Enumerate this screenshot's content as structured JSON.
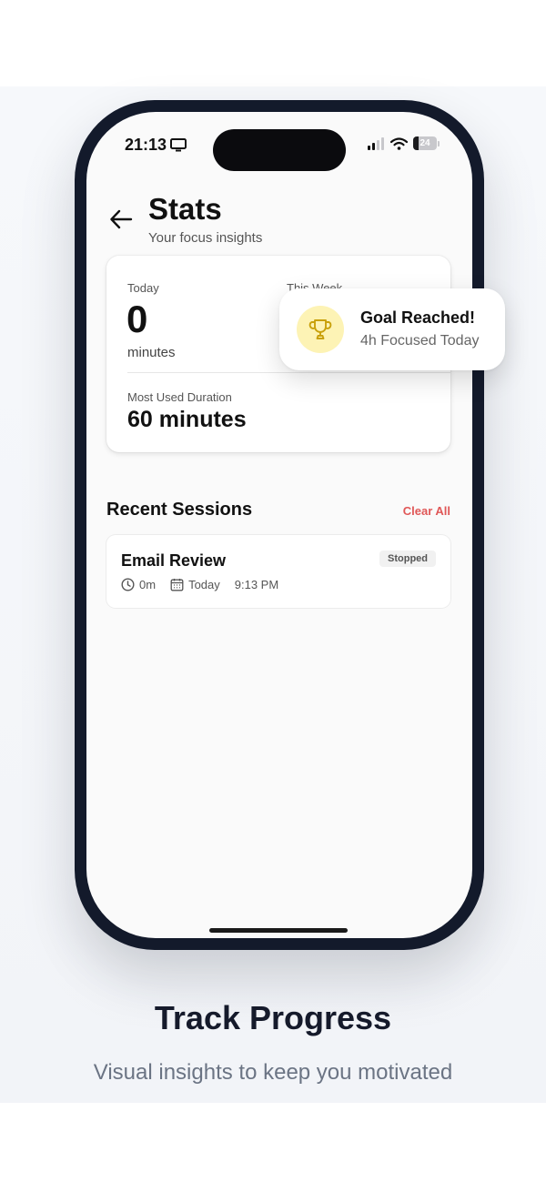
{
  "status_bar": {
    "time": "21:13",
    "battery": "24",
    "battery_level": 0.24
  },
  "header": {
    "title": "Stats",
    "subtitle": "Your focus insights"
  },
  "stats": {
    "today_label": "Today",
    "today_value": "0",
    "today_unit": "minutes",
    "week_label": "This Week",
    "most_used_label": "Most Used Duration",
    "most_used_value": "60 minutes"
  },
  "toast": {
    "title": "Goal Reached!",
    "subtitle": "4h Focused Today"
  },
  "recent": {
    "title": "Recent Sessions",
    "clear_label": "Clear All",
    "sessions": [
      {
        "title": "Email Review",
        "status": "Stopped",
        "duration": "0m",
        "day": "Today",
        "time": "9:13 PM"
      }
    ]
  },
  "promo": {
    "headline": "Track Progress",
    "tagline": "Visual insights to keep you motivated"
  },
  "colors": {
    "frame": "#131a2b",
    "accent_red": "#e05757",
    "trophy": "#c9a10c",
    "trophy_bg": "#fdf3b5"
  },
  "icons": {
    "back": "arrow-left-icon",
    "status_monitor": "monitor-icon",
    "signal": "cellular-signal-icon",
    "wifi": "wifi-icon",
    "battery": "battery-icon",
    "trophy": "trophy-icon",
    "clock": "clock-icon",
    "calendar": "calendar-icon"
  }
}
